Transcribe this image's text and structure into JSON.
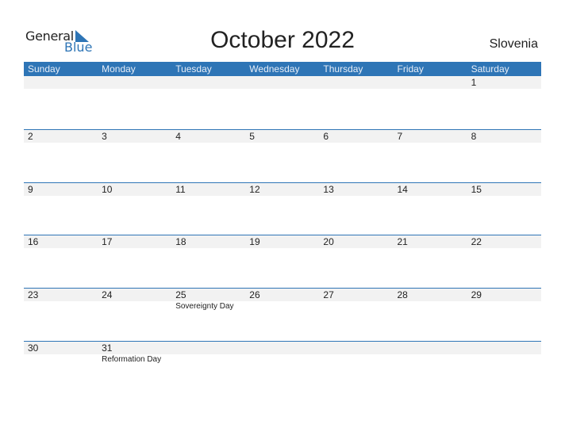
{
  "logo": {
    "general": "General",
    "blue": "Blue"
  },
  "title": "October 2022",
  "country": "Slovenia",
  "colors": {
    "accent": "#2e75b6",
    "band": "#f2f2f2"
  },
  "weekdays": [
    "Sunday",
    "Monday",
    "Tuesday",
    "Wednesday",
    "Thursday",
    "Friday",
    "Saturday"
  ],
  "weeks": [
    [
      {
        "d": ""
      },
      {
        "d": ""
      },
      {
        "d": ""
      },
      {
        "d": ""
      },
      {
        "d": ""
      },
      {
        "d": ""
      },
      {
        "d": "1"
      }
    ],
    [
      {
        "d": "2"
      },
      {
        "d": "3"
      },
      {
        "d": "4"
      },
      {
        "d": "5"
      },
      {
        "d": "6"
      },
      {
        "d": "7"
      },
      {
        "d": "8"
      }
    ],
    [
      {
        "d": "9"
      },
      {
        "d": "10"
      },
      {
        "d": "11"
      },
      {
        "d": "12"
      },
      {
        "d": "13"
      },
      {
        "d": "14"
      },
      {
        "d": "15"
      }
    ],
    [
      {
        "d": "16"
      },
      {
        "d": "17"
      },
      {
        "d": "18"
      },
      {
        "d": "19"
      },
      {
        "d": "20"
      },
      {
        "d": "21"
      },
      {
        "d": "22"
      }
    ],
    [
      {
        "d": "23"
      },
      {
        "d": "24"
      },
      {
        "d": "25",
        "e": "Sovereignty Day"
      },
      {
        "d": "26"
      },
      {
        "d": "27"
      },
      {
        "d": "28"
      },
      {
        "d": "29"
      }
    ],
    [
      {
        "d": "30"
      },
      {
        "d": "31",
        "e": "Reformation Day"
      },
      {
        "d": ""
      },
      {
        "d": ""
      },
      {
        "d": ""
      },
      {
        "d": ""
      },
      {
        "d": ""
      }
    ]
  ]
}
